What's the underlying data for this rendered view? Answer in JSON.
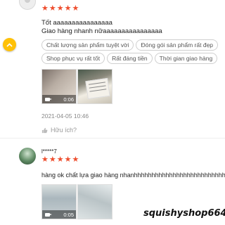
{
  "review1": {
    "stars": 5,
    "text_line1": "Tốt aaaaaaaaaaaaaaaa",
    "text_line2": "Giao hàng nhanh nữaaaaaaaaaaaaaaaa",
    "tags": [
      "Chất lượng sản phẩm tuyệt vời",
      "Đóng gói sản phẩm rất đẹp",
      "Shop phục vụ rất tốt",
      "Rất đáng tiền",
      "Thời gian giao hàng"
    ],
    "media": [
      {
        "type": "video",
        "duration": "0:06"
      },
      {
        "type": "image"
      }
    ],
    "timestamp": "2021-04-05 10:46",
    "helpful_label": "Hữu ích?"
  },
  "review2": {
    "username": "l*****7",
    "stars": 5,
    "text": "hàng ok chất lựa giao hàng nhanhhhhhhhhhhhhhhhhhhhhhhhhhhhhh",
    "media": [
      {
        "type": "video",
        "duration": "0:05"
      },
      {
        "type": "image"
      }
    ]
  },
  "watermark": "squishyshop664",
  "colors": {
    "star": "#ee4d2d",
    "fab": "#ffc107"
  },
  "icons": {
    "fab": "chevron-up-icon",
    "helpful": "thumb-up-icon",
    "video": "camera-icon"
  }
}
